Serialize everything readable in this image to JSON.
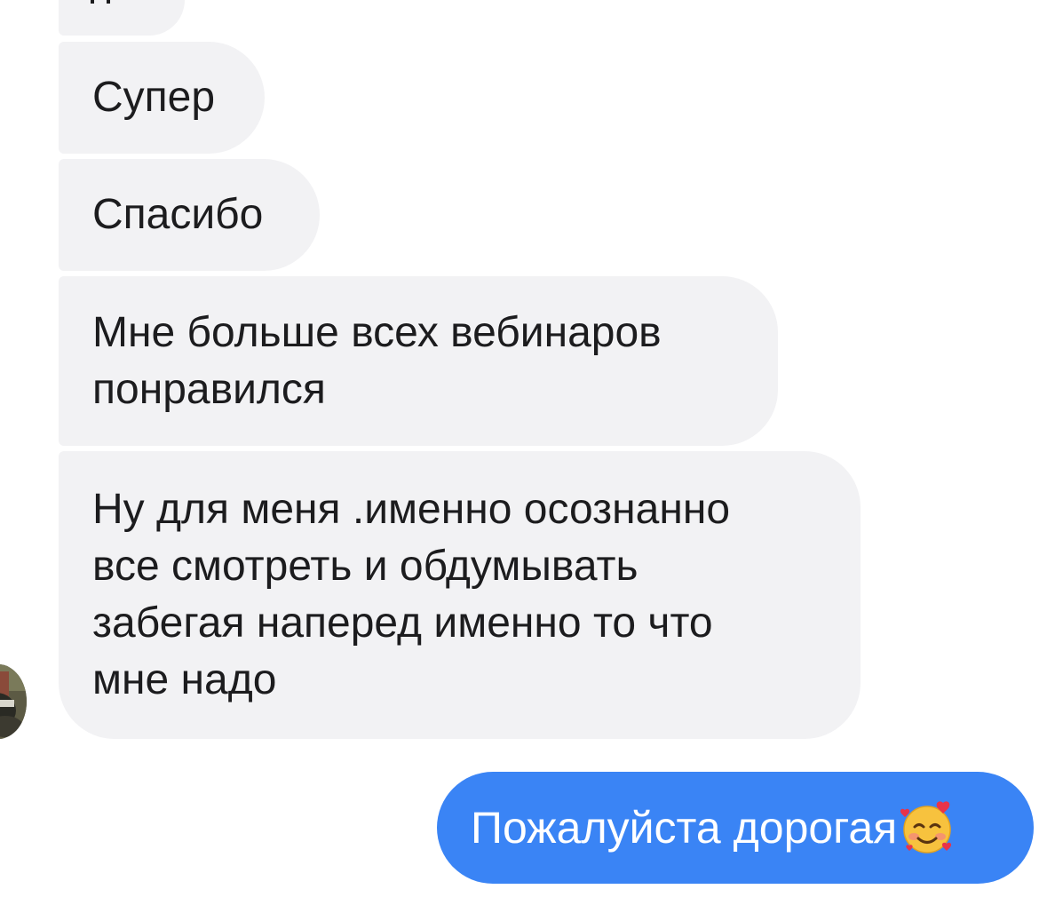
{
  "conversation": {
    "incoming": [
      {
        "text": "Супер"
      },
      {
        "text": "Спасибо"
      },
      {
        "text": "Мне больше всех вебинаров\nпонравился"
      },
      {
        "text": "Ну для меня .именно осознанно\nвсе смотреть и обдумывать\nзабегая наперед именно то что\nмне надо"
      }
    ],
    "outgoing": [
      {
        "text": "Пожалуйста дорогая"
      }
    ]
  },
  "icons": {
    "emoji": "smiling-face-with-hearts-icon",
    "avatar": "contact-avatar"
  },
  "colors": {
    "incoming_bubble": "#f2f2f4",
    "outgoing_bubble": "#3a84f5",
    "incoming_text": "#1c1c1e",
    "outgoing_text": "#ffffff"
  }
}
